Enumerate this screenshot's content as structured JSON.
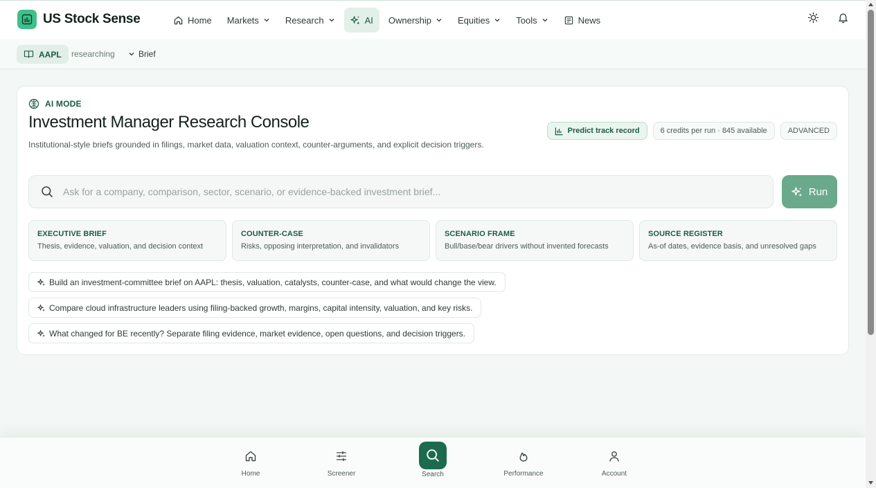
{
  "app": {
    "title": "US Stock Sense"
  },
  "nav": {
    "items": [
      {
        "label": "Home",
        "icon": "home-icon",
        "dropdown": false
      },
      {
        "label": "Markets",
        "dropdown": true
      },
      {
        "label": "Research",
        "dropdown": true
      },
      {
        "label": "AI",
        "icon": "sparkle-icon",
        "dropdown": false,
        "active": true
      },
      {
        "label": "Ownership",
        "dropdown": true
      },
      {
        "label": "Equities",
        "dropdown": true
      },
      {
        "label": "Tools",
        "dropdown": true
      },
      {
        "label": "News",
        "icon": "newspaper-icon",
        "dropdown": false
      }
    ]
  },
  "subbar": {
    "ticker": "AAPL",
    "status": "researching",
    "mode": "Brief"
  },
  "console": {
    "mode_label": "AI MODE",
    "title": "Investment Manager Research Console",
    "description": "Institutional-style briefs grounded in filings, market data, valuation context, counter-arguments, and explicit decision triggers.",
    "badges": {
      "predict": "Predict track record",
      "credits": "6 credits per run · 845 available",
      "level": "ADVANCED"
    },
    "search_placeholder": "Ask for a company, comparison, sector, scenario, or evidence-backed investment brief...",
    "run_label": "Run",
    "features": [
      {
        "title": "EXECUTIVE BRIEF",
        "desc": "Thesis, evidence, valuation, and decision context"
      },
      {
        "title": "COUNTER-CASE",
        "desc": "Risks, opposing interpretation, and invalidators"
      },
      {
        "title": "SCENARIO FRAME",
        "desc": "Bull/base/bear drivers without invented forecasts"
      },
      {
        "title": "SOURCE REGISTER",
        "desc": "As-of dates, evidence basis, and unresolved gaps"
      }
    ],
    "suggestions": [
      "Build an investment-committee brief on AAPL: thesis, valuation, catalysts, counter-case, and what would change the view.",
      "Compare cloud infrastructure leaders using filing-backed growth, margins, capital intensity, valuation, and key risks.",
      "What changed for BE recently? Separate filing evidence, market evidence, open questions, and decision triggers."
    ]
  },
  "bottom_nav": [
    {
      "label": "Home",
      "icon": "home-icon"
    },
    {
      "label": "Screener",
      "icon": "sliders-icon"
    },
    {
      "label": "Search",
      "icon": "search-icon",
      "active": true
    },
    {
      "label": "Performance",
      "icon": "flame-icon"
    },
    {
      "label": "Account",
      "icon": "user-icon"
    }
  ],
  "colors": {
    "accent": "#1d6b4f",
    "accent_light": "#3fbf8a",
    "run": "#6aaa8b"
  }
}
